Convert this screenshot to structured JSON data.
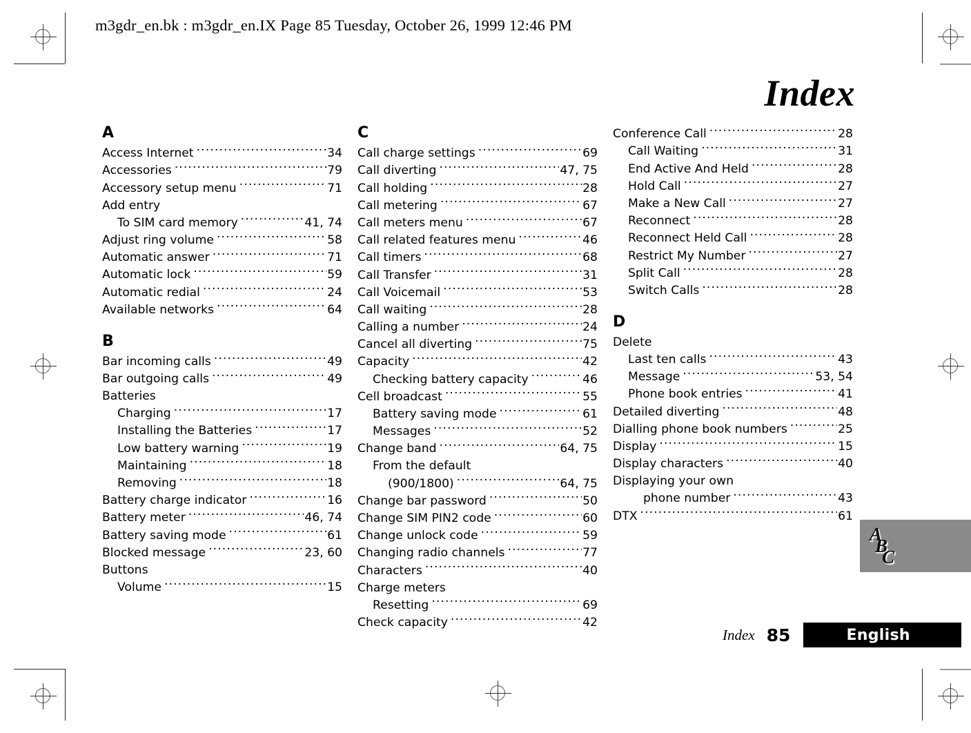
{
  "header": {
    "slug": "m3gdr_en.bk : m3gdr_en.IX  Page 85  Tuesday, October 26, 1999  12:46 PM"
  },
  "title": "Index",
  "columns": [
    {
      "sections": [
        {
          "letter": "A",
          "entries": [
            {
              "term": "Access Internet",
              "pages": "34",
              "level": 0
            },
            {
              "term": "Accessories",
              "pages": "79",
              "level": 0
            },
            {
              "term": "Accessory setup menu",
              "pages": "71",
              "level": 0
            },
            {
              "term": "Add entry",
              "pages": "",
              "level": 0
            },
            {
              "term": "To SIM card memory",
              "pages": "41, 74",
              "level": 1
            },
            {
              "term": "Adjust ring volume",
              "pages": "58",
              "level": 0
            },
            {
              "term": "Automatic answer",
              "pages": "71",
              "level": 0
            },
            {
              "term": "Automatic lock",
              "pages": "59",
              "level": 0
            },
            {
              "term": "Automatic redial",
              "pages": "24",
              "level": 0
            },
            {
              "term": "Available networks",
              "pages": "64",
              "level": 0
            }
          ]
        },
        {
          "letter": "B",
          "entries": [
            {
              "term": "Bar incoming calls",
              "pages": "49",
              "level": 0
            },
            {
              "term": "Bar outgoing calls",
              "pages": "49",
              "level": 0
            },
            {
              "term": "Batteries",
              "pages": "",
              "level": 0
            },
            {
              "term": "Charging",
              "pages": "17",
              "level": 1
            },
            {
              "term": "Installing the Batteries",
              "pages": "17",
              "level": 1
            },
            {
              "term": "Low battery warning",
              "pages": "19",
              "level": 1
            },
            {
              "term": "Maintaining",
              "pages": "18",
              "level": 1
            },
            {
              "term": "Removing",
              "pages": "18",
              "level": 1
            },
            {
              "term": "Battery charge indicator",
              "pages": "16",
              "level": 0
            },
            {
              "term": "Battery meter",
              "pages": "46, 74",
              "level": 0
            },
            {
              "term": "Battery saving mode",
              "pages": "61",
              "level": 0
            },
            {
              "term": "Blocked message",
              "pages": "23, 60",
              "level": 0
            },
            {
              "term": "Buttons",
              "pages": "",
              "level": 0
            },
            {
              "term": "Volume",
              "pages": "15",
              "level": 1
            }
          ]
        }
      ]
    },
    {
      "sections": [
        {
          "letter": "C",
          "entries": [
            {
              "term": "Call charge settings",
              "pages": "69",
              "level": 0
            },
            {
              "term": "Call diverting",
              "pages": "47, 75",
              "level": 0
            },
            {
              "term": "Call holding",
              "pages": "28",
              "level": 0
            },
            {
              "term": "Call metering",
              "pages": "67",
              "level": 0
            },
            {
              "term": "Call meters menu",
              "pages": "67",
              "level": 0
            },
            {
              "term": "Call related features menu",
              "pages": "46",
              "level": 0
            },
            {
              "term": "Call timers",
              "pages": "68",
              "level": 0
            },
            {
              "term": "Call Transfer",
              "pages": "31",
              "level": 0
            },
            {
              "term": "Call Voicemail",
              "pages": "53",
              "level": 0
            },
            {
              "term": "Call waiting",
              "pages": "28",
              "level": 0
            },
            {
              "term": "Calling a number",
              "pages": "24",
              "level": 0
            },
            {
              "term": "Cancel all diverting",
              "pages": "75",
              "level": 0
            },
            {
              "term": "Capacity",
              "pages": "42",
              "level": 0
            },
            {
              "term": "Checking battery capacity",
              "pages": "46",
              "level": 1
            },
            {
              "term": "Cell broadcast",
              "pages": "55",
              "level": 0
            },
            {
              "term": "Battery saving mode",
              "pages": "61",
              "level": 1
            },
            {
              "term": "Messages",
              "pages": "52",
              "level": 1
            },
            {
              "term": "Change band",
              "pages": "64, 75",
              "level": 0
            },
            {
              "term": "From the default",
              "pages": "",
              "level": 1
            },
            {
              "term": "(900/1800)",
              "pages": "64, 75",
              "level": 2
            },
            {
              "term": "Change bar password",
              "pages": "50",
              "level": 0
            },
            {
              "term": "Change SIM PIN2 code",
              "pages": "60",
              "level": 0
            },
            {
              "term": "Change unlock code",
              "pages": "59",
              "level": 0
            },
            {
              "term": "Changing radio channels",
              "pages": "77",
              "level": 0
            },
            {
              "term": "Characters",
              "pages": "40",
              "level": 0
            },
            {
              "term": "Charge meters",
              "pages": "",
              "level": 0
            },
            {
              "term": "Resetting",
              "pages": "69",
              "level": 1
            },
            {
              "term": "Check capacity",
              "pages": "42",
              "level": 0
            }
          ]
        }
      ]
    },
    {
      "sections": [
        {
          "letter": "",
          "entries": [
            {
              "term": "Conference Call",
              "pages": "28",
              "level": 0
            },
            {
              "term": "Call Waiting",
              "pages": "31",
              "level": 1
            },
            {
              "term": "End Active And Held",
              "pages": "28",
              "level": 1
            },
            {
              "term": "Hold Call",
              "pages": "27",
              "level": 1
            },
            {
              "term": "Make a New Call",
              "pages": "27",
              "level": 1
            },
            {
              "term": "Reconnect",
              "pages": "28",
              "level": 1
            },
            {
              "term": "Reconnect Held Call",
              "pages": "28",
              "level": 1
            },
            {
              "term": "Restrict My Number",
              "pages": "27",
              "level": 1
            },
            {
              "term": "Split Call",
              "pages": "28",
              "level": 1
            },
            {
              "term": "Switch Calls",
              "pages": "28",
              "level": 1
            }
          ]
        },
        {
          "letter": "D",
          "entries": [
            {
              "term": "Delete",
              "pages": "",
              "level": 0
            },
            {
              "term": "Last ten calls",
              "pages": "43",
              "level": 1
            },
            {
              "term": "Message",
              "pages": "53, 54",
              "level": 1
            },
            {
              "term": "Phone book entries",
              "pages": "41",
              "level": 1
            },
            {
              "term": "Detailed diverting",
              "pages": "48",
              "level": 0
            },
            {
              "term": "Dialling phone book numbers",
              "pages": "25",
              "level": 0
            },
            {
              "term": "Display",
              "pages": "15",
              "level": 0
            },
            {
              "term": "Display characters",
              "pages": "40",
              "level": 0
            },
            {
              "term": "Displaying your own",
              "pages": "",
              "level": 0
            },
            {
              "term": "phone number",
              "pages": "43",
              "level": 2
            },
            {
              "term": "DTX",
              "pages": "61",
              "level": 0
            }
          ]
        }
      ]
    }
  ],
  "thumb_tab": {
    "letters": [
      "A",
      "B",
      "C"
    ],
    "background_color": "#8a8a8a"
  },
  "footer": {
    "section": "Index",
    "page_number": "85",
    "language": "English",
    "bar_color": "#000000"
  }
}
